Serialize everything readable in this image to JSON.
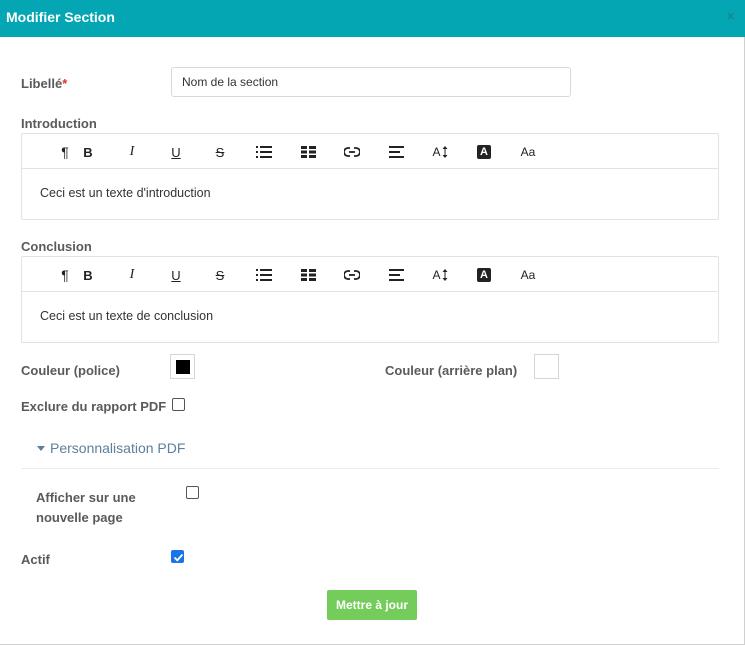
{
  "header": {
    "title": "Modifier Section",
    "close_icon": "×"
  },
  "fields": {
    "libelle": {
      "label": "Libellé",
      "required_mark": "*",
      "value": "Nom de la section"
    },
    "introduction": {
      "label": "Introduction",
      "content": "Ceci est un texte d'introduction"
    },
    "conclusion": {
      "label": "Conclusion",
      "content": "Ceci est un texte de conclusion"
    },
    "font_color": {
      "label": "Couleur (police)",
      "value": "#000000"
    },
    "bg_color": {
      "label": "Couleur (arrière plan)",
      "value": "#ffffff"
    },
    "exclude_pdf": {
      "label": "Exclure du rapport PDF",
      "checked": false
    },
    "new_page": {
      "label_line1": "Afficher sur une",
      "label_line2": "nouvelle page",
      "checked": false
    },
    "active": {
      "label": "Actif",
      "checked": true
    }
  },
  "pdf_section": {
    "toggle_label": "Personnalisation PDF",
    "expanded": true
  },
  "toolbar": {
    "buttons": [
      {
        "name": "paragraph-icon",
        "glyph": "¶"
      },
      {
        "name": "bold-icon",
        "glyph": "B"
      },
      {
        "name": "italic-icon",
        "glyph": "I"
      },
      {
        "name": "underline-icon",
        "glyph": "U"
      },
      {
        "name": "strikethrough-icon",
        "glyph": "S"
      },
      {
        "name": "bullet-list-icon",
        "glyph": ""
      },
      {
        "name": "table-icon",
        "glyph": ""
      },
      {
        "name": "link-icon",
        "glyph": ""
      },
      {
        "name": "align-icon",
        "glyph": ""
      },
      {
        "name": "font-size-icon",
        "glyph": "A"
      },
      {
        "name": "text-color-icon",
        "glyph": "A"
      },
      {
        "name": "font-family-icon",
        "glyph": "Aa"
      }
    ]
  },
  "actions": {
    "submit_label": "Mettre à jour"
  },
  "colors": {
    "header_bg": "#04a6b3",
    "submit_bg": "#74cc5a",
    "checkbox_checked": "#1a73e8",
    "link": "#5d7f9c"
  }
}
